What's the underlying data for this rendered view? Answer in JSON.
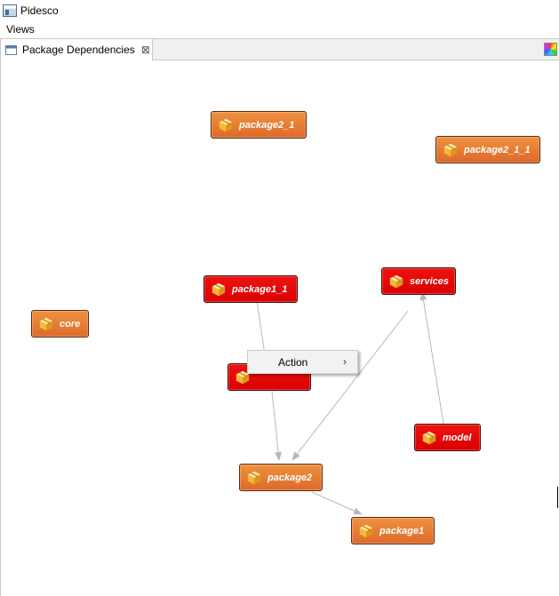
{
  "window": {
    "title": "Pidesco"
  },
  "menubar": {
    "items": [
      "Views"
    ]
  },
  "view": {
    "tab_label": "Package Dependencies",
    "close_glyph": "⊠"
  },
  "icons": {
    "app": "window-icon",
    "tab": "view-icon",
    "node": "package-icon",
    "palette": "color-palette-icon"
  },
  "colors": {
    "orange_node": "#e07a30",
    "red_node": "#e60000",
    "edge": "#b8b8b8"
  },
  "graph": {
    "nodes": [
      {
        "id": "package2_1",
        "label": "package2_1",
        "style": "orange"
      },
      {
        "id": "package2_1_1",
        "label": "package2_1_1",
        "style": "orange"
      },
      {
        "id": "package1_1",
        "label": "package1_1",
        "style": "red"
      },
      {
        "id": "services",
        "label": "services",
        "style": "red"
      },
      {
        "id": "core",
        "label": "core",
        "style": "orange"
      },
      {
        "id": "hidden",
        "label": "",
        "style": "red"
      },
      {
        "id": "model",
        "label": "model",
        "style": "red"
      },
      {
        "id": "package2",
        "label": "package2",
        "style": "orange"
      },
      {
        "id": "package1",
        "label": "package1",
        "style": "orange"
      }
    ],
    "edges": [
      {
        "from": "hidden",
        "to": "package1_1"
      },
      {
        "from": "hidden",
        "to": "package2"
      },
      {
        "from": "services",
        "to": "package2"
      },
      {
        "from": "model",
        "to": "services"
      },
      {
        "from": "package2",
        "to": "package1"
      }
    ]
  },
  "context_menu": {
    "items": [
      {
        "label": "Action",
        "submenu_glyph": "›"
      }
    ]
  }
}
